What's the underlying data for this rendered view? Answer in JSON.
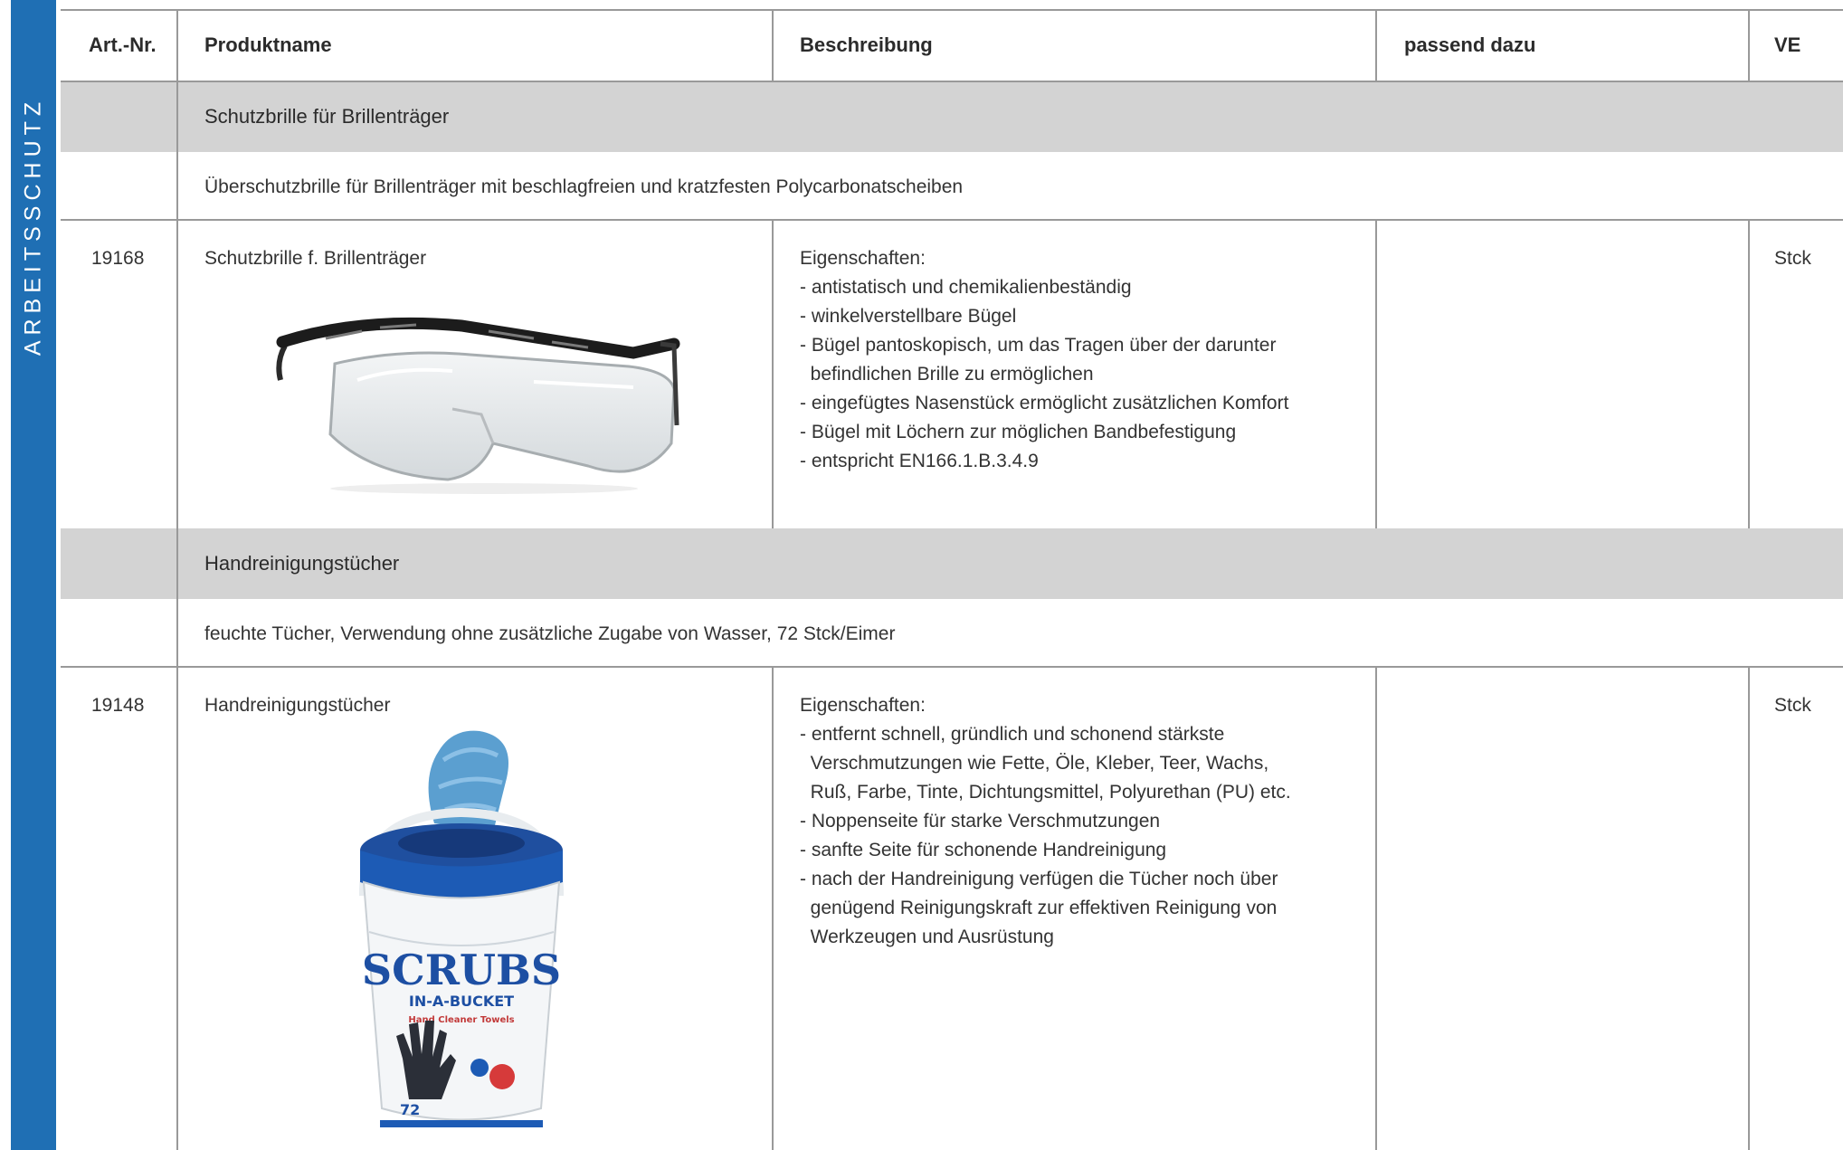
{
  "sidebar": {
    "label": "ARBEITSSCHUTZ",
    "color": "#1f6fb4"
  },
  "table": {
    "headers": {
      "art_nr": "Art.-Nr.",
      "produktname": "Produktname",
      "beschreibung": "Beschreibung",
      "passend": "passend dazu",
      "ve": "VE"
    },
    "groups": [
      {
        "title": "Schutzbrille für Brillenträger",
        "intro": "Überschutzbrille für Brillenträger mit beschlagfreien und kratzfesten Polycarbonatscheiben",
        "product": {
          "art_nr": "19168",
          "name": "Schutzbrille f. Brillenträger",
          "image_icon": "safety-glasses-image",
          "description": "Eigenschaften:\n- antistatisch und chemikalienbeständig\n- winkelverstellbare Bügel\n- Bügel pantoskopisch, um das Tragen über der darunter\n  befindlichen Brille zu ermöglichen\n- eingefügtes Nasenstück ermöglicht zusätzlichen Komfort\n- Bügel mit Löchern zur möglichen Bandbefestigung\n- entspricht EN166.1.B.3.4.9",
          "passend": "",
          "ve": "Stck"
        }
      },
      {
        "title": "Handreinigungstücher",
        "intro": "feuchte Tücher, Verwendung ohne zusätzliche Zugabe von Wasser, 72 Stck/Eimer",
        "product": {
          "art_nr": "19148",
          "name": "Handreinigungstücher",
          "image_icon": "wipes-bucket-image",
          "image_text": {
            "brand": "SCRUBS",
            "sub": "IN-A-BUCKET",
            "tag": "Hand Cleaner Towels",
            "count": "72"
          },
          "description": "Eigenschaften:\n- entfernt schnell, gründlich und schonend stärkste\n  Verschmutzungen wie Fette, Öle, Kleber, Teer, Wachs,\n  Ruß, Farbe, Tinte, Dichtungsmittel, Polyurethan (PU) etc.\n- Noppenseite für starke Verschmutzungen\n- sanfte Seite für schonende Handreinigung\n- nach der Handreinigung verfügen die Tücher noch über\n  genügend Reinigungskraft zur effektiven Reinigung von\n  Werkzeugen und Ausrüstung",
          "passend": "",
          "ve": "Stck"
        }
      }
    ]
  }
}
